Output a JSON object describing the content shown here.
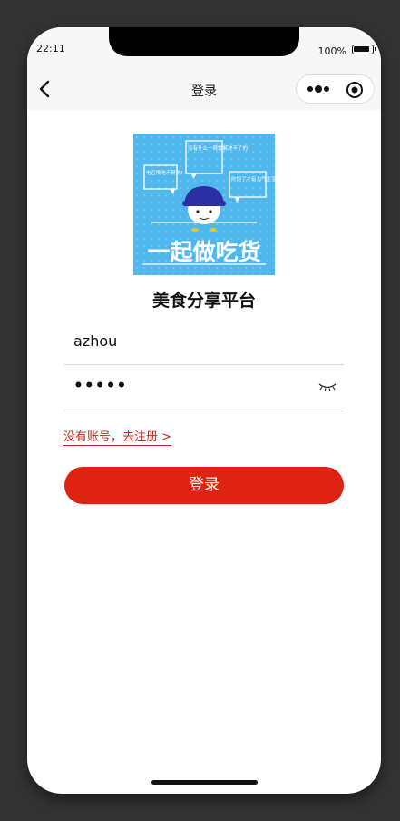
{
  "status": {
    "time": "22:11",
    "battery": "100%"
  },
  "nav": {
    "title": "登录"
  },
  "logo": {
    "bubbles": [
      "电召唤吃不胖的!",
      "没有什么一顿饭解决不了的",
      "吃饱了才有力气生活"
    ],
    "banner": "一起做吃货"
  },
  "app": {
    "title": "美食分享平台"
  },
  "form": {
    "username": "azhou",
    "password_mask": "•••••",
    "register_link": "没有账号，去注册 >",
    "login_button": "登录"
  },
  "colors": {
    "accent": "#de2313",
    "link": "#c8281a",
    "logo_bg": "#4fb7ec"
  }
}
